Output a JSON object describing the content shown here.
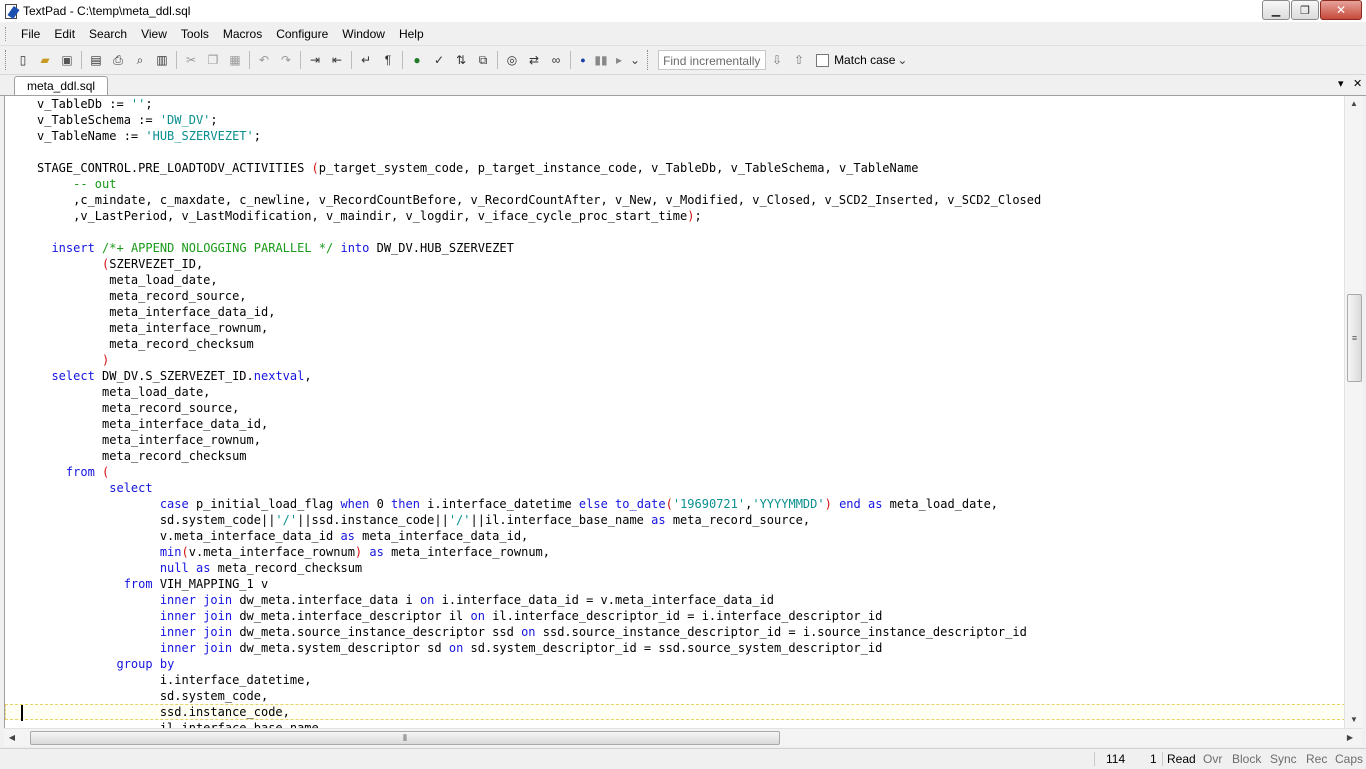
{
  "window": {
    "title": "TextPad - C:\\temp\\meta_ddl.sql",
    "minimize_glyph": "▁",
    "maximize_glyph": "❐",
    "close_glyph": "✕"
  },
  "menu": {
    "items": [
      "File",
      "Edit",
      "Search",
      "View",
      "Tools",
      "Macros",
      "Configure",
      "Window",
      "Help"
    ]
  },
  "toolbar": {
    "icons": [
      "new-file-icon",
      "open-folder-icon",
      "save-icon",
      "save-all-icon",
      "print-icon",
      "print-preview-icon",
      "spell-icon",
      "cut-icon",
      "copy-icon",
      "paste-icon",
      "undo-icon",
      "redo-icon",
      "indent-icon",
      "outdent-icon",
      "word-wrap-icon",
      "pilcrow-icon",
      "browser-icon",
      "spellcheck-icon",
      "sort-icon",
      "compare-icon",
      "find-icon",
      "replace-icon",
      "binoculars-icon",
      "record-macro-icon",
      "play-macro-icon",
      "run-macro-icon"
    ],
    "find_placeholder": "Find incrementally",
    "match_case_label": "Match case",
    "match_case_checked": false
  },
  "tab": {
    "label": "meta_ddl.sql",
    "dropdown_glyph": "▾",
    "close_glyph": "✕"
  },
  "editor": {
    "current_line_index": 38,
    "lines": [
      [
        [
          "v_TableDb := ",
          ""
        ],
        [
          "''",
          "str"
        ],
        [
          ";",
          ""
        ]
      ],
      [
        [
          "v_TableSchema := ",
          ""
        ],
        [
          "'DW_DV'",
          "str"
        ],
        [
          ";",
          ""
        ]
      ],
      [
        [
          "v_TableName := ",
          ""
        ],
        [
          "'HUB_SZERVEZET'",
          "str"
        ],
        [
          ";",
          ""
        ]
      ],
      [],
      [
        [
          "STAGE_CONTROL.PRE_LOADTODV_ACTIVITIES ",
          ""
        ],
        [
          "(",
          "pn"
        ],
        [
          "p_target_system_code, p_target_instance_code, v_TableDb, v_TableSchema, v_TableName",
          ""
        ]
      ],
      [
        [
          "     ",
          ""
        ],
        [
          "-- out",
          "cm"
        ]
      ],
      [
        [
          "     ,c_mindate, c_maxdate, c_newline, v_RecordCountBefore, v_RecordCountAfter, v_New, v_Modified, v_Closed, v_SCD2_Inserted, v_SCD2_Closed",
          ""
        ]
      ],
      [
        [
          "     ,v_LastPeriod, v_LastModification, v_maindir, v_logdir, v_iface_cycle_proc_start_time",
          ""
        ],
        [
          ")",
          "pn"
        ],
        [
          ";",
          ""
        ]
      ],
      [],
      [
        [
          "  ",
          ""
        ],
        [
          "insert",
          "kw"
        ],
        [
          " ",
          ""
        ],
        [
          "/*+ APPEND NOLOGGING PARALLEL */",
          "cm"
        ],
        [
          " ",
          ""
        ],
        [
          "into",
          "kw"
        ],
        [
          " DW_DV.HUB_SZERVEZET",
          ""
        ]
      ],
      [
        [
          "         ",
          ""
        ],
        [
          "(",
          "pn"
        ],
        [
          "SZERVEZET_ID,",
          ""
        ]
      ],
      [
        [
          "          meta_load_date,",
          ""
        ]
      ],
      [
        [
          "          meta_record_source,",
          ""
        ]
      ],
      [
        [
          "          meta_interface_data_id,",
          ""
        ]
      ],
      [
        [
          "          meta_interface_rownum,",
          ""
        ]
      ],
      [
        [
          "          meta_record_checksum",
          ""
        ]
      ],
      [
        [
          "         ",
          ""
        ],
        [
          ")",
          "pn"
        ]
      ],
      [
        [
          "  ",
          ""
        ],
        [
          "select",
          "kw"
        ],
        [
          " DW_DV.S_SZERVEZET_ID.",
          ""
        ],
        [
          "nextval",
          "kw"
        ],
        [
          ",",
          ""
        ]
      ],
      [
        [
          "         meta_load_date,",
          ""
        ]
      ],
      [
        [
          "         meta_record_source,",
          ""
        ]
      ],
      [
        [
          "         meta_interface_data_id,",
          ""
        ]
      ],
      [
        [
          "         meta_interface_rownum,",
          ""
        ]
      ],
      [
        [
          "         meta_record_checksum",
          ""
        ]
      ],
      [
        [
          "    ",
          ""
        ],
        [
          "from",
          "kw"
        ],
        [
          " ",
          ""
        ],
        [
          "(",
          "pn"
        ]
      ],
      [
        [
          "          ",
          ""
        ],
        [
          "select",
          "kw"
        ]
      ],
      [
        [
          "                 ",
          ""
        ],
        [
          "case",
          "kw"
        ],
        [
          " p_initial_load_flag ",
          ""
        ],
        [
          "when",
          "kw"
        ],
        [
          " 0 ",
          ""
        ],
        [
          "then",
          "kw"
        ],
        [
          " i.interface_datetime ",
          ""
        ],
        [
          "else",
          "kw"
        ],
        [
          " ",
          ""
        ],
        [
          "to_date",
          "kw"
        ],
        [
          "(",
          "pn"
        ],
        [
          "'19690721'",
          "str"
        ],
        [
          ",",
          ""
        ],
        [
          "'YYYYMMDD'",
          "str"
        ],
        [
          ")",
          "pn"
        ],
        [
          " ",
          ""
        ],
        [
          "end",
          "kw"
        ],
        [
          " ",
          ""
        ],
        [
          "as",
          "kw"
        ],
        [
          " meta_load_date,",
          ""
        ]
      ],
      [
        [
          "                 sd.system_code||",
          ""
        ],
        [
          "'/'",
          "str"
        ],
        [
          "||ssd.instance_code||",
          ""
        ],
        [
          "'/'",
          "str"
        ],
        [
          "||il.interface_base_name ",
          ""
        ],
        [
          "as",
          "kw"
        ],
        [
          " meta_record_source,",
          ""
        ]
      ],
      [
        [
          "                 v.meta_interface_data_id ",
          ""
        ],
        [
          "as",
          "kw"
        ],
        [
          " meta_interface_data_id,",
          ""
        ]
      ],
      [
        [
          "                 ",
          ""
        ],
        [
          "min",
          "kw"
        ],
        [
          "(",
          "pn"
        ],
        [
          "v.meta_interface_rownum",
          ""
        ],
        [
          ")",
          "pn"
        ],
        [
          " ",
          ""
        ],
        [
          "as",
          "kw"
        ],
        [
          " meta_interface_rownum,",
          ""
        ]
      ],
      [
        [
          "                 ",
          ""
        ],
        [
          "null",
          "kw"
        ],
        [
          " ",
          ""
        ],
        [
          "as",
          "kw"
        ],
        [
          " meta_record_checksum",
          ""
        ]
      ],
      [
        [
          "            ",
          ""
        ],
        [
          "from",
          "kw"
        ],
        [
          " VIH_MAPPING_1 v",
          ""
        ]
      ],
      [
        [
          "                 ",
          ""
        ],
        [
          "inner",
          "kw"
        ],
        [
          " ",
          ""
        ],
        [
          "join",
          "kw"
        ],
        [
          " dw_meta.interface_data i ",
          ""
        ],
        [
          "on",
          "kw"
        ],
        [
          " i.interface_data_id = v.meta_interface_data_id",
          ""
        ]
      ],
      [
        [
          "                 ",
          ""
        ],
        [
          "inner",
          "kw"
        ],
        [
          " ",
          ""
        ],
        [
          "join",
          "kw"
        ],
        [
          " dw_meta.interface_descriptor il ",
          ""
        ],
        [
          "on",
          "kw"
        ],
        [
          " il.interface_descriptor_id = i.interface_descriptor_id",
          ""
        ]
      ],
      [
        [
          "                 ",
          ""
        ],
        [
          "inner",
          "kw"
        ],
        [
          " ",
          ""
        ],
        [
          "join",
          "kw"
        ],
        [
          " dw_meta.source_instance_descriptor ssd ",
          ""
        ],
        [
          "on",
          "kw"
        ],
        [
          " ssd.source_instance_descriptor_id = i.source_instance_descriptor_id",
          ""
        ]
      ],
      [
        [
          "                 ",
          ""
        ],
        [
          "inner",
          "kw"
        ],
        [
          " ",
          ""
        ],
        [
          "join",
          "kw"
        ],
        [
          " dw_meta.system_descriptor sd ",
          ""
        ],
        [
          "on",
          "kw"
        ],
        [
          " sd.system_descriptor_id = ssd.source_system_descriptor_id",
          ""
        ]
      ],
      [
        [
          "           ",
          ""
        ],
        [
          "group",
          "kw"
        ],
        [
          " ",
          ""
        ],
        [
          "by",
          "kw"
        ]
      ],
      [
        [
          "                 i.interface_datetime,",
          ""
        ]
      ],
      [
        [
          "                 sd.system_code,",
          ""
        ]
      ],
      [
        [
          "                 ssd.instance_code,",
          ""
        ]
      ],
      [
        [
          "                 il.interface_base_name,",
          ""
        ]
      ]
    ]
  },
  "statusbar": {
    "line": "114",
    "column": "1",
    "read": "Read",
    "ovr": "Ovr",
    "block": "Block",
    "sync": "Sync",
    "rec": "Rec",
    "caps": "Caps"
  },
  "colors": {
    "keyword": "#1515e0",
    "string": "#0a8f8f",
    "comment": "#1a9a1a",
    "paren": "#d21010"
  }
}
